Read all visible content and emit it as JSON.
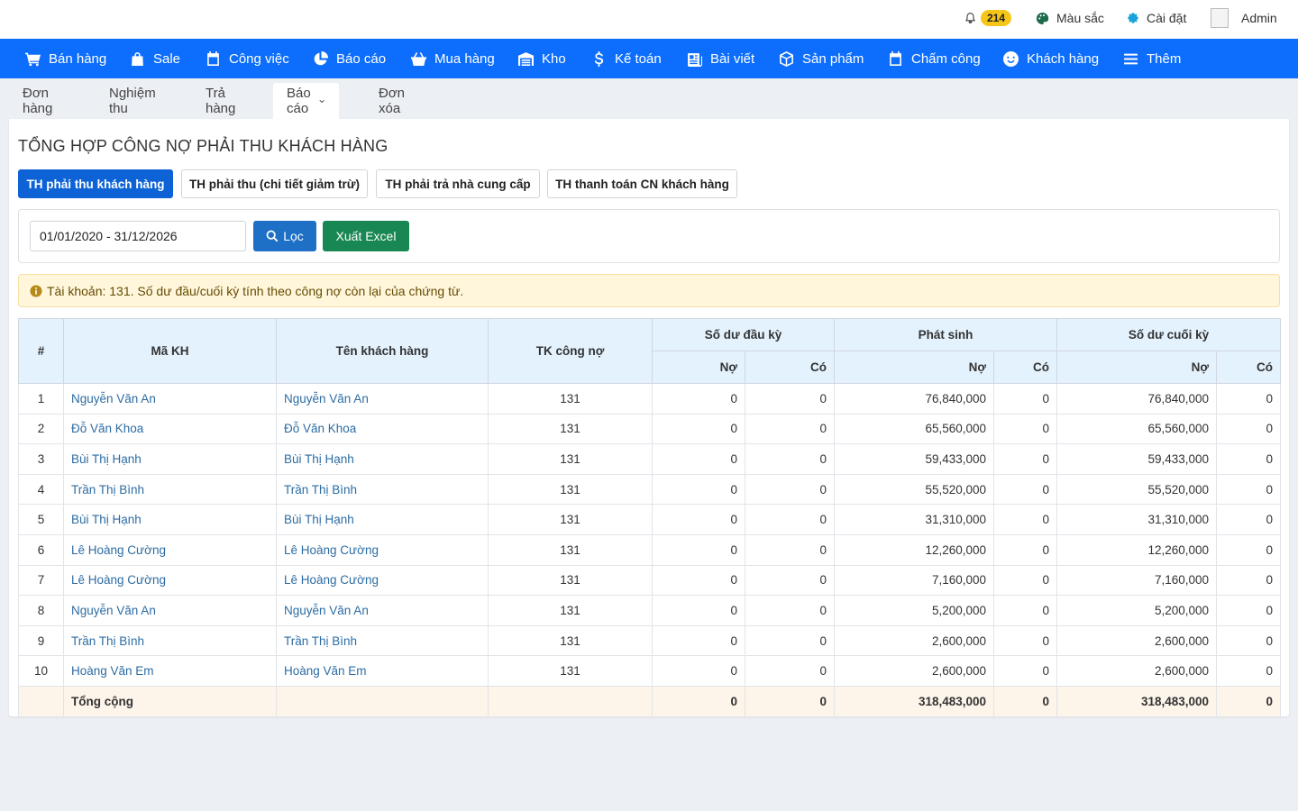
{
  "topbar": {
    "notif_count": "214",
    "color_label": "Màu sắc",
    "settings_label": "Cài đặt",
    "avatar_alt": "lo",
    "user_label": "Admin"
  },
  "nav": {
    "items": [
      {
        "label": "Bán hàng",
        "icon": "cart-icon"
      },
      {
        "label": "Sale",
        "icon": "bag-icon"
      },
      {
        "label": "Công việc",
        "icon": "calendar-icon"
      },
      {
        "label": "Báo cáo",
        "icon": "pie-chart-icon"
      },
      {
        "label": "Mua hàng",
        "icon": "basket-icon"
      },
      {
        "label": "Kho",
        "icon": "warehouse-icon"
      },
      {
        "label": "Kế toán",
        "icon": "dollar-icon"
      },
      {
        "label": "Bài viết",
        "icon": "newspaper-icon"
      },
      {
        "label": "Sản phẩm",
        "icon": "box-icon"
      },
      {
        "label": "Chấm công",
        "icon": "calendar-icon"
      },
      {
        "label": "Khách hàng",
        "icon": "smile-icon"
      },
      {
        "label": "Thêm",
        "icon": "menu-icon"
      }
    ]
  },
  "subtabs": {
    "items": [
      "Đơn hàng",
      "Nghiệm thu",
      "Trả hàng",
      "Báo cáo",
      "Đơn xóa"
    ],
    "active": "Báo cáo"
  },
  "page": {
    "title": "TỔNG HỢP CÔNG NỢ PHẢI THU KHÁCH HÀNG"
  },
  "report_tabs": {
    "items": [
      "TH phải thu khách hàng",
      "TH phải thu (chi tiết giảm trừ)",
      "TH phải trả nhà cung cấp",
      "TH thanh toán CN khách hàng"
    ],
    "active": "TH phải thu khách hàng"
  },
  "filter": {
    "date_range": "01/01/2020 - 31/12/2026",
    "filter_button": "Lọc",
    "excel_button": "Xuất Excel"
  },
  "alert": {
    "text": "Tài khoản: 131. Số dư đầu/cuối kỳ tính theo công nợ còn lại của chứng từ."
  },
  "table": {
    "headers": {
      "index": "#",
      "code": "Mã KH",
      "name": "Tên khách hàng",
      "account": "TK công nợ",
      "opening": "Số dư đầu kỳ",
      "movement": "Phát sinh",
      "closing": "Số dư cuối kỳ",
      "debit": "Nợ",
      "credit": "Có"
    },
    "rows": [
      {
        "idx": "1",
        "code": "Nguyễn Văn An",
        "name": "Nguyễn Văn An",
        "acct": "131",
        "open_no": "0",
        "open_co": "0",
        "ps_no": "76,840,000",
        "ps_co": "0",
        "close_no": "76,840,000",
        "close_co": "0"
      },
      {
        "idx": "2",
        "code": "Đỗ Văn Khoa",
        "name": "Đỗ Văn Khoa",
        "acct": "131",
        "open_no": "0",
        "open_co": "0",
        "ps_no": "65,560,000",
        "ps_co": "0",
        "close_no": "65,560,000",
        "close_co": "0"
      },
      {
        "idx": "3",
        "code": "Bùi Thị Hạnh",
        "name": "Bùi Thị Hạnh",
        "acct": "131",
        "open_no": "0",
        "open_co": "0",
        "ps_no": "59,433,000",
        "ps_co": "0",
        "close_no": "59,433,000",
        "close_co": "0"
      },
      {
        "idx": "4",
        "code": "Trần Thị Bình",
        "name": "Trần Thị Bình",
        "acct": "131",
        "open_no": "0",
        "open_co": "0",
        "ps_no": "55,520,000",
        "ps_co": "0",
        "close_no": "55,520,000",
        "close_co": "0"
      },
      {
        "idx": "5",
        "code": "Bùi Thị Hạnh",
        "name": "Bùi Thị Hạnh",
        "acct": "131",
        "open_no": "0",
        "open_co": "0",
        "ps_no": "31,310,000",
        "ps_co": "0",
        "close_no": "31,310,000",
        "close_co": "0"
      },
      {
        "idx": "6",
        "code": "Lê Hoàng Cường",
        "name": "Lê Hoàng Cường",
        "acct": "131",
        "open_no": "0",
        "open_co": "0",
        "ps_no": "12,260,000",
        "ps_co": "0",
        "close_no": "12,260,000",
        "close_co": "0"
      },
      {
        "idx": "7",
        "code": "Lê Hoàng Cường",
        "name": "Lê Hoàng Cường",
        "acct": "131",
        "open_no": "0",
        "open_co": "0",
        "ps_no": "7,160,000",
        "ps_co": "0",
        "close_no": "7,160,000",
        "close_co": "0"
      },
      {
        "idx": "8",
        "code": "Nguyễn Văn An",
        "name": "Nguyễn Văn An",
        "acct": "131",
        "open_no": "0",
        "open_co": "0",
        "ps_no": "5,200,000",
        "ps_co": "0",
        "close_no": "5,200,000",
        "close_co": "0"
      },
      {
        "idx": "9",
        "code": "Trần Thị Bình",
        "name": "Trần Thị Bình",
        "acct": "131",
        "open_no": "0",
        "open_co": "0",
        "ps_no": "2,600,000",
        "ps_co": "0",
        "close_no": "2,600,000",
        "close_co": "0"
      },
      {
        "idx": "10",
        "code": "Hoàng Văn Em",
        "name": "Hoàng Văn Em",
        "acct": "131",
        "open_no": "0",
        "open_co": "0",
        "ps_no": "2,600,000",
        "ps_co": "0",
        "close_no": "2,600,000",
        "close_co": "0"
      }
    ],
    "total": {
      "label": "Tổng cộng",
      "open_no": "0",
      "open_co": "0",
      "ps_no": "318,483,000",
      "ps_co": "0",
      "close_no": "318,483,000",
      "close_co": "0"
    }
  },
  "colors": {
    "nav_bg": "#0d6efd",
    "active_tab": "#0d63d6",
    "filter_button": "#1e6fc6",
    "excel_button": "#198754",
    "badge": "#f5c518",
    "link": "#2c6ca3",
    "header_bg": "#e3f2fd",
    "total_bg": "#fdf4ea"
  }
}
